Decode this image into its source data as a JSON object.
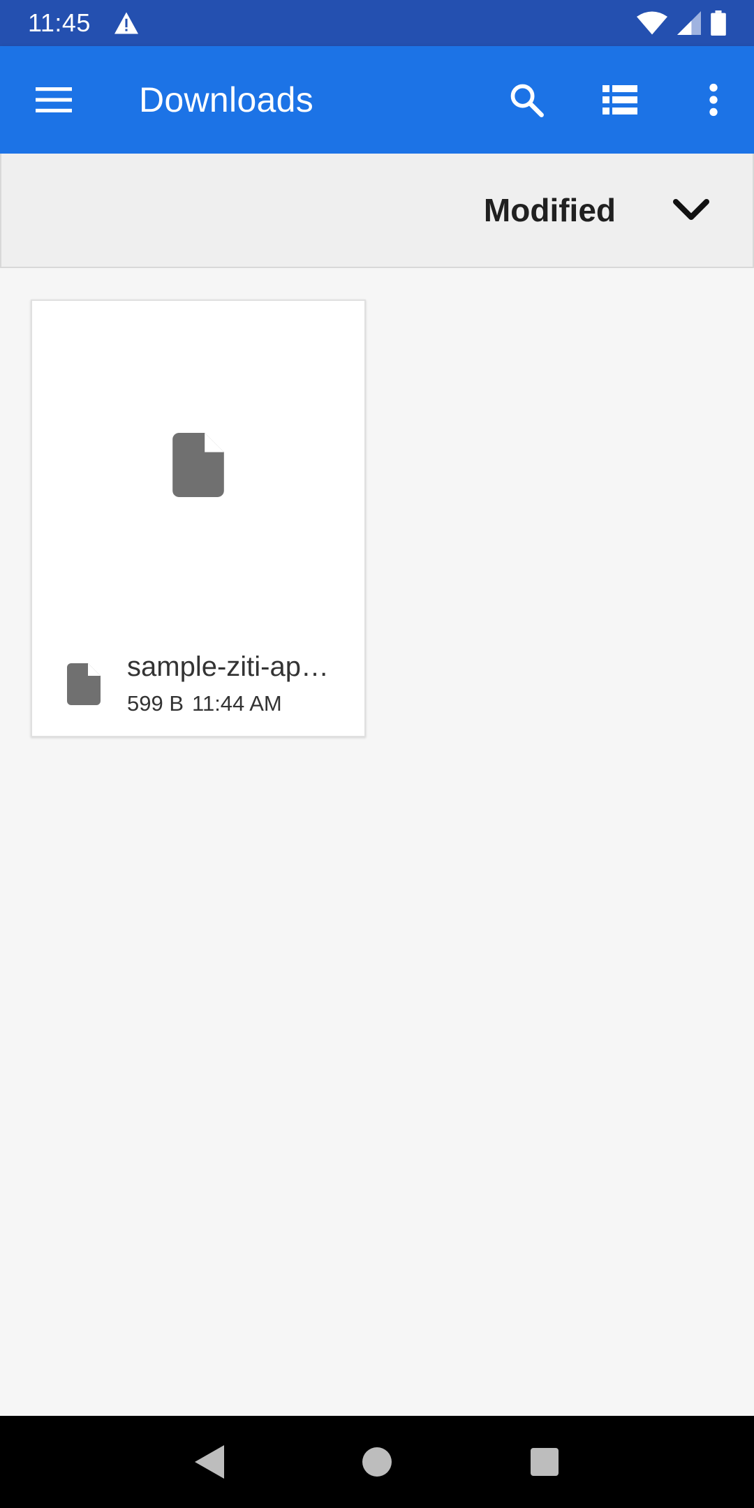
{
  "status_bar": {
    "time": "11:45",
    "icons": [
      "warning-icon",
      "wifi-icon",
      "signal-icon",
      "battery-icon"
    ]
  },
  "app_bar": {
    "title": "Downloads",
    "icons": [
      "menu-icon",
      "search-icon",
      "list-view-icon",
      "more-vert-icon"
    ],
    "color": "#1c73e6"
  },
  "sort_bar": {
    "label": "Modified",
    "icon": "chevron-down-icon"
  },
  "files": [
    {
      "name": "sample-ziti-ap…",
      "size": "599 B",
      "time": "11:44 AM",
      "icon": "file-icon"
    }
  ],
  "nav_bar": {
    "icons": [
      "back-icon",
      "home-icon",
      "recents-icon"
    ]
  }
}
